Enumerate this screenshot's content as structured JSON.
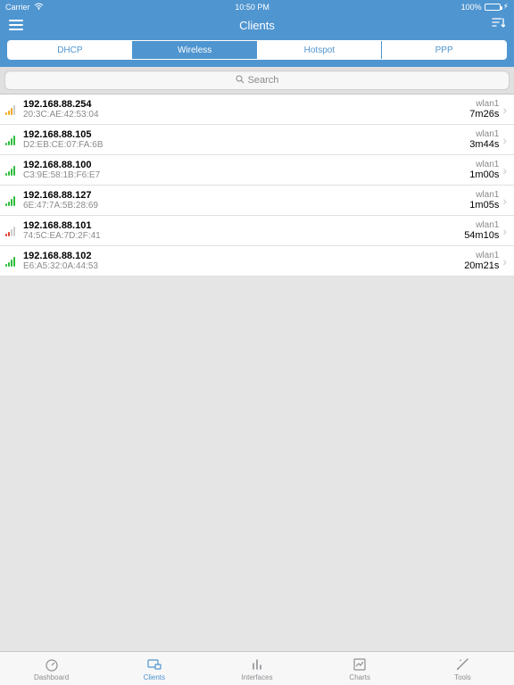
{
  "status": {
    "carrier": "Carrier",
    "time": "10:50 PM",
    "battery": "100%"
  },
  "nav": {
    "title": "Clients"
  },
  "segments": [
    "DHCP",
    "Wireless",
    "Hotspot",
    "PPP"
  ],
  "active_segment": 1,
  "search": {
    "placeholder": "Search"
  },
  "clients": [
    {
      "signal": "orange",
      "ip": "192.168.88.254",
      "mac": "20:3C:AE:42:53:04",
      "iface": "wlan1",
      "uptime": "7m26s"
    },
    {
      "signal": "green",
      "ip": "192.168.88.105",
      "mac": "D2:EB:CE:07:FA:6B",
      "iface": "wlan1",
      "uptime": "3m44s"
    },
    {
      "signal": "green",
      "ip": "192.168.88.100",
      "mac": "C3:9E:58:1B:F6:E7",
      "iface": "wlan1",
      "uptime": "1m00s"
    },
    {
      "signal": "green",
      "ip": "192.168.88.127",
      "mac": "6E:47:7A:5B:28:69",
      "iface": "wlan1",
      "uptime": "1m05s"
    },
    {
      "signal": "red",
      "ip": "192.168.88.101",
      "mac": "74:5C:EA:7D:2F:41",
      "iface": "wlan1",
      "uptime": "54m10s"
    },
    {
      "signal": "green",
      "ip": "192.168.88.102",
      "mac": "E6:A5:32:0A:44:53",
      "iface": "wlan1",
      "uptime": "20m21s"
    }
  ],
  "tabs": [
    {
      "id": "dashboard",
      "label": "Dashboard"
    },
    {
      "id": "clients",
      "label": "Clients"
    },
    {
      "id": "interfaces",
      "label": "Interfaces"
    },
    {
      "id": "charts",
      "label": "Charts"
    },
    {
      "id": "tools",
      "label": "Tools"
    }
  ],
  "active_tab": 1
}
